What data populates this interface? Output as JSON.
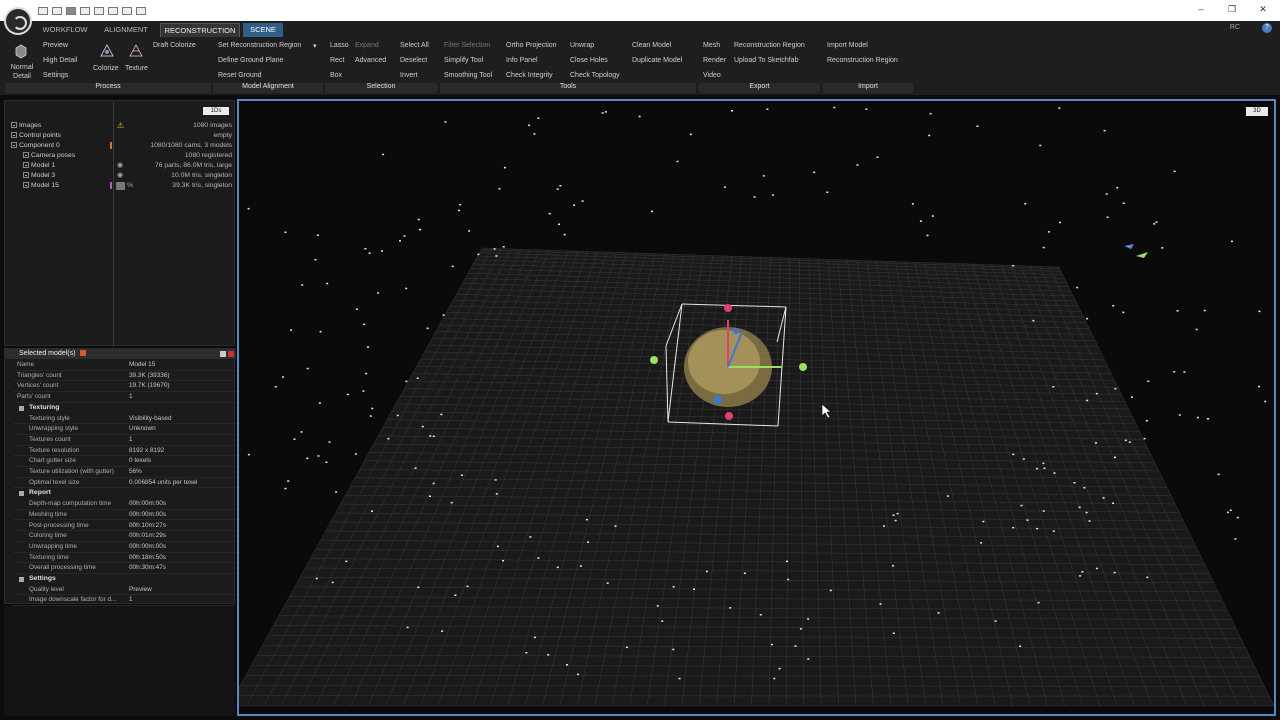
{
  "ribbon": {
    "tabs": [
      "WORKFLOW",
      "ALIGNMENT",
      "RECONSTRUCTION",
      "SCENE"
    ],
    "active_tab": "RECONSTRUCTION",
    "rc_label": "RC",
    "help": "?",
    "process": {
      "normal_detail": "Normal\nDetail",
      "preview": "Preview",
      "high_detail": "High Detail",
      "settings": "Settings",
      "colorize": "Colorize",
      "texture": "Texture",
      "draft_colorize": "Draft Colorize",
      "group": "Process"
    },
    "model_alignment": {
      "set_region": "Set Reconstruction Region",
      "define_ground": "Define Ground Plane",
      "reset_ground": "Reset Ground",
      "group": "Model Alignment"
    },
    "selection": {
      "lasso": "Lasso",
      "expand": "Expand",
      "rect": "Rect",
      "advanced": "Advanced",
      "box": "Box",
      "select_all": "Select All",
      "deselect": "Deselect",
      "invert": "Invert",
      "group": "Selection"
    },
    "tools": {
      "filter_selection": "Filter Selection",
      "simplify_tool": "Simplify Tool",
      "smoothing_tool": "Smoothing Tool",
      "ortho_projection": "Ortho Projection",
      "info_panel": "Info Panel",
      "check_integrity": "Check Integrity",
      "unwrap": "Unwrap",
      "close_holes": "Close Holes",
      "check_topology": "Check Topology",
      "clean_model": "Clean Model",
      "duplicate_model": "Duplicate Model",
      "group": "Tools"
    },
    "export": {
      "mesh": "Mesh",
      "render": "Render",
      "video": "Video",
      "reconstruction_region": "Reconstruction Region",
      "upload_sketchfab": "Upload To Sketchfab",
      "group": "Export"
    },
    "import": {
      "import_model": "Import Model",
      "reconstruction_region": "Reconstruction Region",
      "group": "Import"
    }
  },
  "tree": {
    "view_button": "1Ds",
    "rows": [
      {
        "label": "Images",
        "value": "1080 images"
      },
      {
        "label": "Control points",
        "value": "empty"
      },
      {
        "label": "Component 0",
        "value": "1080/1080 cams, 3 models"
      },
      {
        "label": "Camera poses",
        "value": "1080 registered"
      },
      {
        "label": "Model 1",
        "value": "76 parts, 86.0M tris, large"
      },
      {
        "label": "Model 3",
        "value": "10.0M tris, singleton"
      },
      {
        "label": "Model 15",
        "value": "39.3K tris, singleton"
      }
    ]
  },
  "props": {
    "title": "Selected model(s)",
    "rows": [
      {
        "k": "Name",
        "v": "Model 15"
      },
      {
        "k": "Triangles' count",
        "v": "39.3K (39336)"
      },
      {
        "k": "Vertices' count",
        "v": "19.7K (19670)"
      },
      {
        "k": "Parts' count",
        "v": "1"
      }
    ],
    "texturing_title": "Texturing",
    "texturing": [
      {
        "k": "Texturing style",
        "v": "Visibility-based"
      },
      {
        "k": "Unwrapping style",
        "v": "Unknown"
      },
      {
        "k": "Textures count",
        "v": "1"
      },
      {
        "k": "Texture resolution",
        "v": "8192 x 8192"
      },
      {
        "k": "Chart gutter size",
        "v": "0 texels"
      },
      {
        "k": "Texture utilization (with gutter)",
        "v": "56%"
      },
      {
        "k": "Optimal texel size",
        "v": "0.006854 units per texel"
      }
    ],
    "report_title": "Report",
    "report": [
      {
        "k": "Depth-map computation time",
        "v": "00h:00m:00s"
      },
      {
        "k": "Meshing time",
        "v": "00h:00m:00s"
      },
      {
        "k": "Post-processing time",
        "v": "00h:10m:27s"
      },
      {
        "k": "Coloring time",
        "v": "00h:01m:29s"
      },
      {
        "k": "Unwrapping time",
        "v": "00h:00m:00s"
      },
      {
        "k": "Texturing time",
        "v": "00h:18m:50s"
      },
      {
        "k": "Overall processing time",
        "v": "00h:30m:47s"
      }
    ],
    "settings_title": "Settings",
    "settings": [
      {
        "k": "Quality level",
        "v": "Preview"
      },
      {
        "k": "Image downscale factor for d...",
        "v": "1"
      }
    ]
  },
  "viewport": {
    "mode": "3D"
  },
  "colors": {
    "accent": "#5a86c2",
    "scene_tab": "#2f5f88",
    "gizmo_red": "#e0406a",
    "gizmo_green": "#9be060",
    "gizmo_blue": "#3a78d8"
  }
}
